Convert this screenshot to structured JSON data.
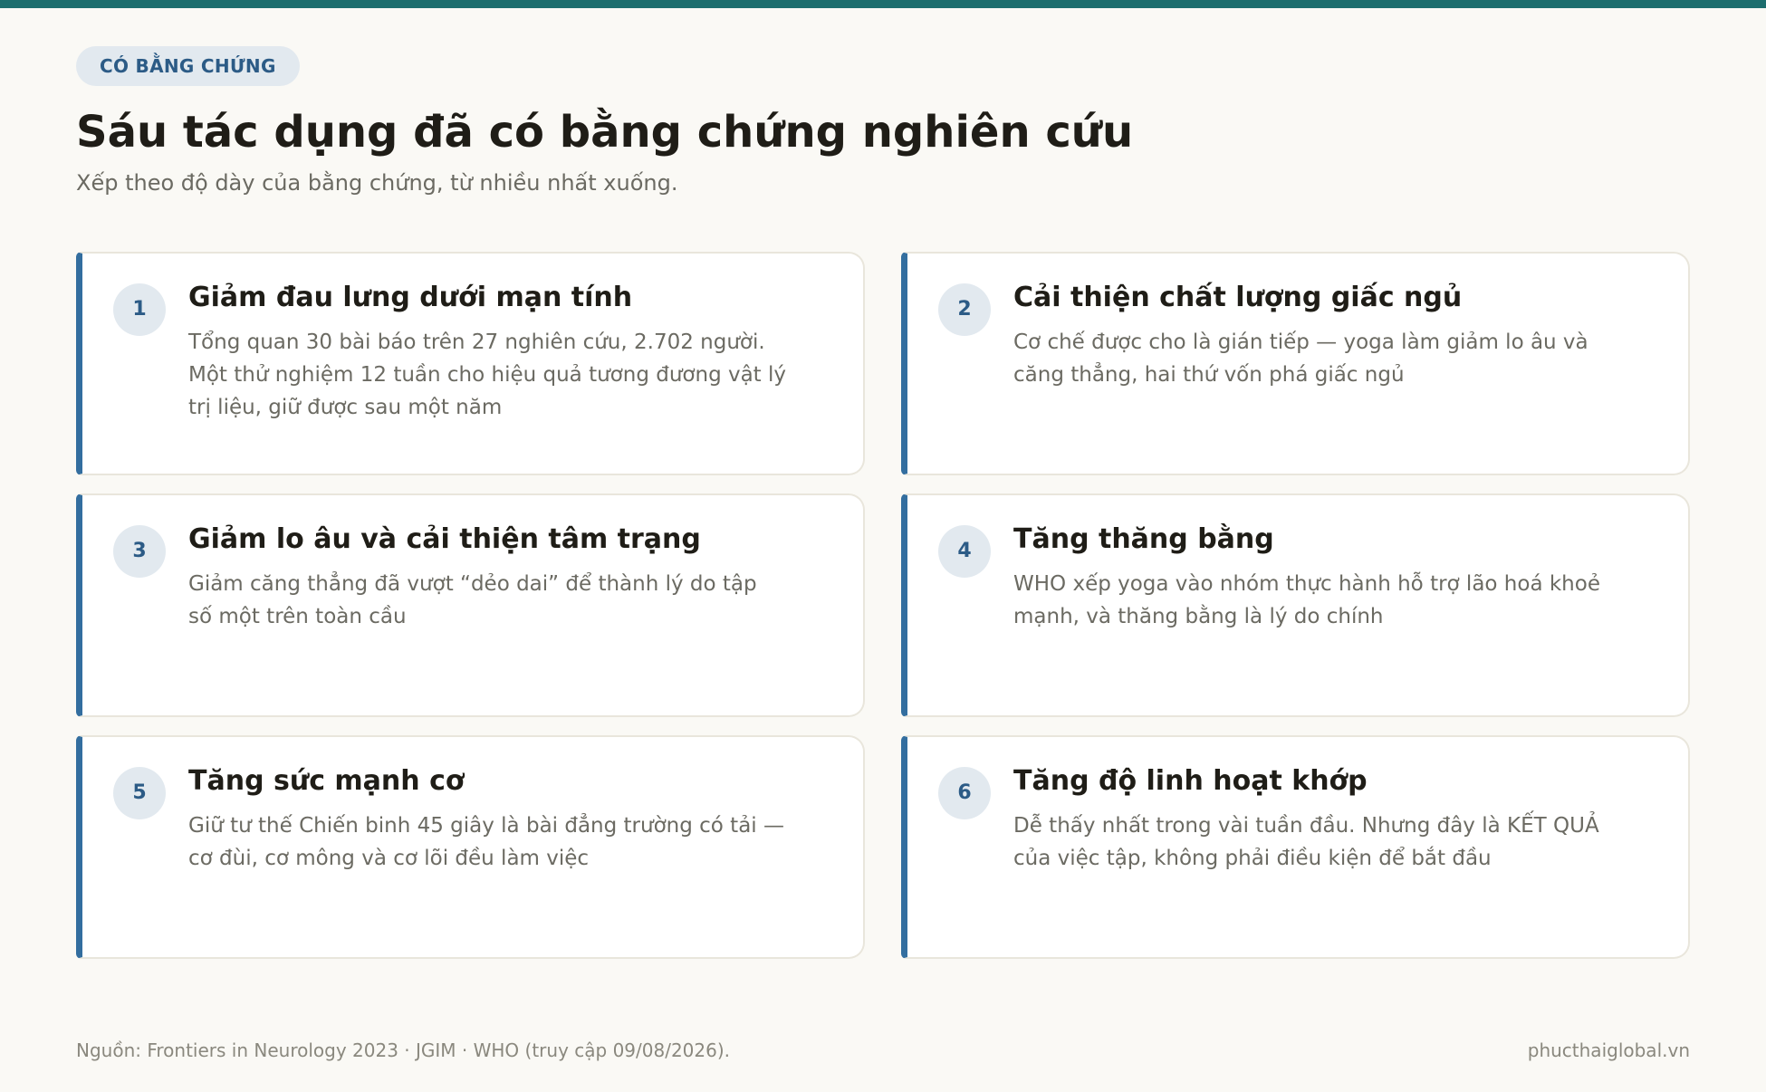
{
  "badge": "CÓ BẰNG CHỨNG",
  "title": "Sáu tác dụng đã có bằng chứng nghiên cứu",
  "subtitle": "Xếp theo độ dày của bằng chứng, từ nhiều nhất xuống.",
  "cards": [
    {
      "number": "1",
      "title": "Giảm đau lưng dưới mạn tính",
      "desc": "Tổng quan 30 bài báo trên 27 nghiên cứu, 2.702 người. Một thử nghiệm 12 tuần cho hiệu quả tương đương vật lý trị liệu, giữ được sau một năm"
    },
    {
      "number": "2",
      "title": "Cải thiện chất lượng giấc ngủ",
      "desc": "Cơ chế được cho là gián tiếp — yoga làm giảm lo âu và căng thẳng, hai thứ vốn phá giấc ngủ"
    },
    {
      "number": "3",
      "title": "Giảm lo âu và cải thiện tâm trạng",
      "desc": "Giảm căng thẳng đã vượt “dẻo dai” để thành lý do tập số một trên toàn cầu"
    },
    {
      "number": "4",
      "title": "Tăng thăng bằng",
      "desc": "WHO xếp yoga vào nhóm thực hành hỗ trợ lão hoá khoẻ mạnh, và thăng bằng là lý do chính"
    },
    {
      "number": "5",
      "title": "Tăng sức mạnh cơ",
      "desc": "Giữ tư thế Chiến binh 45 giây là bài đẳng trường có tải — cơ đùi, cơ mông và cơ lõi đều làm việc"
    },
    {
      "number": "6",
      "title": "Tăng độ linh hoạt khớp",
      "desc": "Dễ thấy nhất trong vài tuần đầu. Nhưng đây là KẾT QUẢ của việc tập, không phải điều kiện để bắt đầu"
    }
  ],
  "footer": {
    "source": "Nguồn: Frontiers in Neurology 2023 · JGIM · WHO (truy cập 09/08/2026).",
    "site": "phucthaiglobal.vn"
  },
  "colors": {
    "accent": "#336e9f",
    "top_bar": "#1d6e6e",
    "badge_bg": "#e2e9ef",
    "badge_text": "#2c5b86",
    "background": "#faf9f5"
  }
}
